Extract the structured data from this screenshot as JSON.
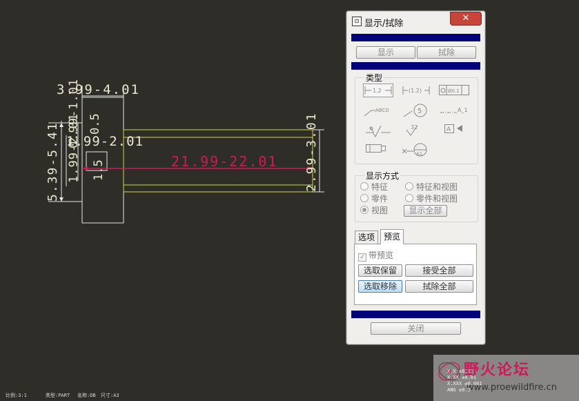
{
  "drawing": {
    "dim_top": "3.99-4.01",
    "dim_left_outer": "5.39-5.41",
    "dim_left_a": "1.99-2.01",
    "dim_left_b": "0.99-1.01",
    "dim_left_c": "1.99-2.01",
    "dim_left_d": "0.5",
    "dim_left_e": "1.5",
    "dim_main": "21.99-22.01",
    "dim_right": "2.99-3.01"
  },
  "dialog": {
    "title": "显示/拭除",
    "close_label": "✕",
    "show_button": "显示",
    "erase_button": "拭除",
    "type_group": "类型",
    "type_icons": [
      "dimension-icon",
      "reference-dimension-icon",
      "geometric-tolerance-icon",
      "note-icon",
      "balloon-icon",
      "axis-icon",
      "surface-finish-icon",
      "symbol-icon",
      "datum-target-icon",
      "cosmetic-feature-icon",
      "datum-icon"
    ],
    "icon_labels": {
      "dim": "1.2",
      "refdim": "(1.2)",
      "gtol": "Ø0.1",
      "note": "ABCD",
      "balloon": "5",
      "axis": "A_1",
      "symbol": "32",
      "datum_a": "A",
      "datum_a1": "A1"
    },
    "display_group": "显示方式",
    "radio": {
      "feature": "特征",
      "feature_view": "特征和视图",
      "part": "零件",
      "part_view": "零件和视图",
      "view": "视图",
      "show_all": "显示全部"
    },
    "tabs": {
      "options": "选项",
      "preview": "预览"
    },
    "with_preview": "带预览",
    "select_keep": "选取保留",
    "accept_all": "接受全部",
    "select_remove": "选取移除",
    "erase_all": "拭除全部",
    "close_button": "关闭"
  },
  "status": {
    "scale": "比例:3:1",
    "type": "类型:PART",
    "name": "名称:DB",
    "size": "尺寸:A3"
  },
  "watermark": {
    "title": "野火论坛",
    "url": "www.proewildfire.cn",
    "tol1": "X.X ±0.1",
    "tol2": "X.XX ±0.01",
    "tol3": "X.XXX ±0.001",
    "tol4": "ANG ±0.5"
  },
  "colors": {
    "background": "#2f2d28",
    "dimension_text": "#e8e8d0",
    "highlight_red": "#d0195a",
    "part_outline": "#d8d84a",
    "dialog_blue": "#02037b",
    "close_red": "#c8433a"
  }
}
